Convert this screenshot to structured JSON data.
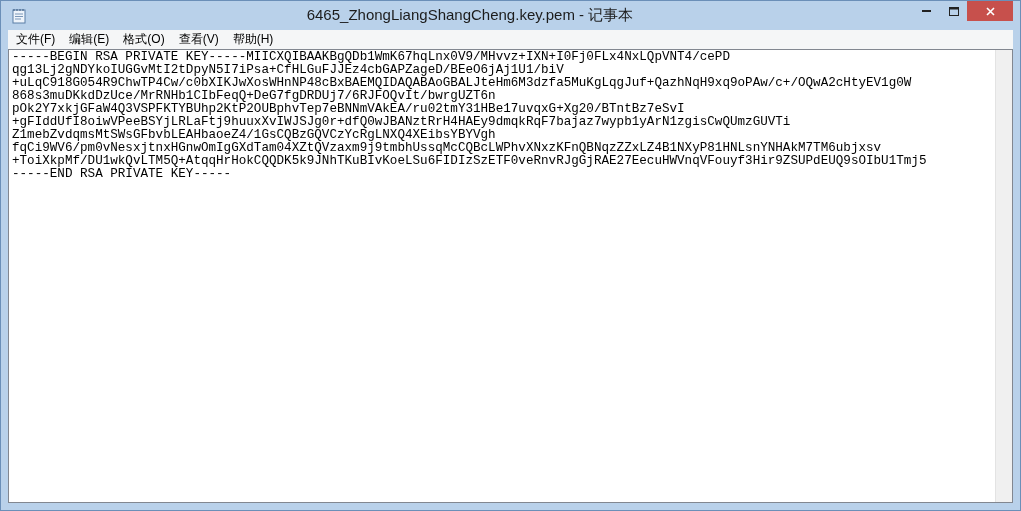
{
  "window": {
    "title": "6465_ZhongLiangShangCheng.key.pem - 记事本"
  },
  "menu": [
    "文件(F)",
    "编辑(E)",
    "格式(O)",
    "查看(V)",
    "帮助(H)"
  ],
  "lines": [
    "-----BEGIN RSA PRIVATE KEY-----MIICXQIBAAKBgQDb1WmK67hqLnx0V9/MHvvz+IXN+I0Fj0FLx4NxLQpVNT4/cePD",
    "qg13Lj2gNDYkoIUGGvMtI2tDpyN5I7iPsa+CfHLGuFJJEz4cbGAPZageD/BEeO6jAj1U1/biV",
    "+uLqC918G054R9ChwTP4Cw/c0bXIKJwXosWHnNP48cBxBAEMQIDAQABAoGBALJteHm6M3dzfa5MuKgLqgJuf+QazhNqH9xq9oPAw/c+/OQwA2cHtyEV1g0W",
    "868s3muDKkdDzUce/MrRNHb1CIbFeqQ+DeG7fgDRDUj7/6RJFOQvIt/bwrgUZT6n",
    "pOk2Y7xkjGFaW4Q3VSPFKTYBUhp2KtP2OUBphvTep7eBNNmVAkEA/ru02tmY31HBe17uvqxG+Xg20/BTntBz7eSvI",
    "+gFIddUfI8oiwVPeeBSYjLRLaFtj9huuxXvIWJSJg0r+dfQ0wJBANztRrH4HAEy9dmqkRqF7bajaz7wypb1yArN1zgisCwQUmzGUVTi",
    "Z1mebZvdqmsMtSWsGFbvbLEAHbaoeZ4/1GsCQBzGQVCzYcRgLNXQ4XEibsYBYVgh",
    "fqCi9WV6/pm0vNesxjtnxHGnwOmIgGXdTam04XZtQVzaxm9j9tmbhUssqMcCQBcLWPhvXNxzKFnQBNqzZZxLZ4B1NXyP81HNLsnYNHAkM7TM6ubjxsv",
    "+ToiXkpMf/DU1wkQvLTM5Q+AtqqHrHokCQQDK5k9JNhTKuBIvKoeLSu6FIDIzSzETF0veRnvRJgGjRAE27EecuHWVnqVFouyf3Hir9ZSUPdEUQ9sOIbU1Tmj5",
    "-----END RSA PRIVATE KEY-----"
  ]
}
